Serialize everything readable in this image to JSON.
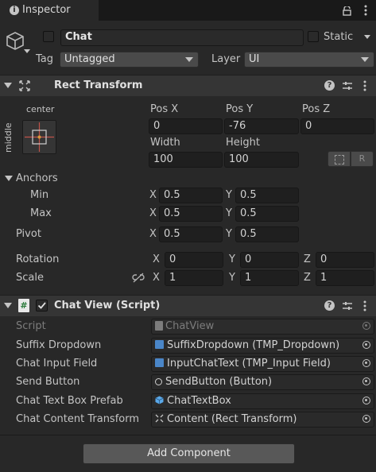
{
  "tab": {
    "title": "Inspector",
    "icon": "info-icon"
  },
  "object": {
    "name": "Chat",
    "static_label": "Static",
    "tag_label": "Tag",
    "tag_value": "Untagged",
    "layer_label": "Layer",
    "layer_value": "UI"
  },
  "rect_transform": {
    "title": "Rect Transform",
    "anchor_preset": {
      "horizontal": "center",
      "vertical": "middle"
    },
    "headers": {
      "pos_x": "Pos X",
      "pos_y": "Pos Y",
      "pos_z": "Pos Z",
      "width": "Width",
      "height": "Height"
    },
    "pos_x": "0",
    "pos_y": "-76",
    "pos_z": "0",
    "width": "100",
    "height": "100",
    "raw_button": "R",
    "anchors_label": "Anchors",
    "min_label": "Min",
    "min_x": "0.5",
    "min_y": "0.5",
    "max_label": "Max",
    "max_x": "0.5",
    "max_y": "0.5",
    "pivot_label": "Pivot",
    "pivot_x": "0.5",
    "pivot_y": "0.5",
    "rotation_label": "Rotation",
    "rot_x": "0",
    "rot_y": "0",
    "rot_z": "0",
    "scale_label": "Scale",
    "scale_x": "1",
    "scale_y": "1",
    "scale_z": "1",
    "axis": {
      "x": "X",
      "y": "Y",
      "z": "Z"
    }
  },
  "chat_view": {
    "title": "Chat View (Script)",
    "fields": [
      {
        "label": "Script",
        "value": "ChatView"
      },
      {
        "label": "Suffix Dropdown",
        "value": "SuffixDropdown (TMP_Dropdown)"
      },
      {
        "label": "Chat Input Field",
        "value": "InputChatText (TMP_Input Field)"
      },
      {
        "label": "Send Button",
        "value": "SendButton (Button)"
      },
      {
        "label": "Chat Text Box Prefab",
        "value": "ChatTextBox"
      },
      {
        "label": "Chat Content Transform",
        "value": "Content (Rect Transform)"
      }
    ]
  },
  "add_component": "Add Component",
  "colors": {
    "panel": "#282828",
    "header": "#353535",
    "field": "#1f1f1f",
    "checkbox_blue": "#4a86c8"
  }
}
